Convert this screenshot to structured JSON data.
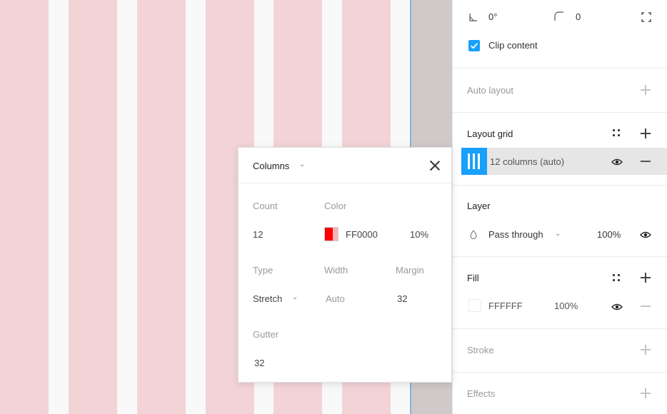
{
  "canvas": {
    "column_color": "#f3d4d6",
    "columns_visible": 6
  },
  "panel": {
    "transform": {
      "rotation": "0°",
      "corner_radius": "0"
    },
    "clip_content": {
      "label": "Clip content",
      "checked": true
    },
    "auto_layout": {
      "title": "Auto layout"
    },
    "layout_grid": {
      "title": "Layout grid",
      "item_label": "12 columns (auto)"
    },
    "layer": {
      "title": "Layer",
      "blend_mode": "Pass through",
      "opacity": "100%"
    },
    "fill": {
      "title": "Fill",
      "hex": "FFFFFF",
      "opacity": "100%"
    },
    "stroke": {
      "title": "Stroke"
    },
    "effects": {
      "title": "Effects"
    }
  },
  "popup": {
    "type_dropdown": "Columns",
    "count_label": "Count",
    "count_value": "12",
    "color_label": "Color",
    "color_hex": "FF0000",
    "color_opacity": "10%",
    "type_label": "Type",
    "type_value": "Stretch",
    "width_label": "Width",
    "width_value": "Auto",
    "margin_label": "Margin",
    "margin_value": "32",
    "gutter_label": "Gutter",
    "gutter_value": "32"
  },
  "colors": {
    "accent": "#18a0fb",
    "grid_color": "#ff0000"
  }
}
